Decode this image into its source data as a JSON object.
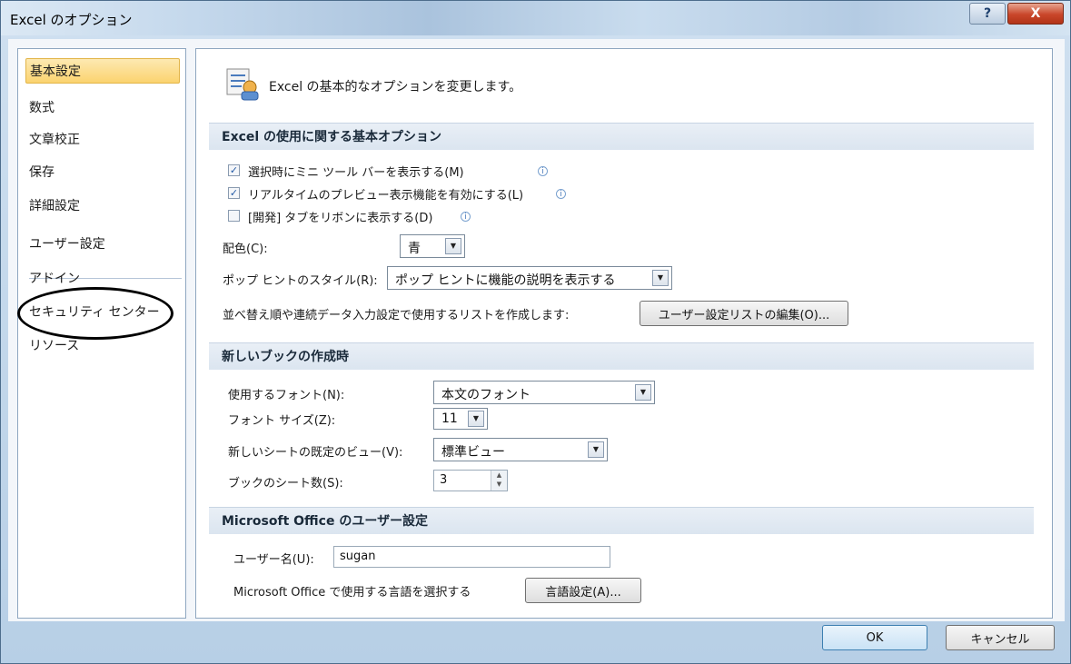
{
  "window": {
    "title": "Excel のオプション",
    "help_label": "?",
    "close_label": "X"
  },
  "sidebar": {
    "items": [
      {
        "label": "基本設定"
      },
      {
        "label": "数式"
      },
      {
        "label": "文章校正"
      },
      {
        "label": "保存"
      },
      {
        "label": "詳細設定"
      },
      {
        "label": "ユーザー設定"
      },
      {
        "label": "アドイン"
      },
      {
        "label": "セキュリティ センター"
      },
      {
        "label": "リソース"
      }
    ]
  },
  "header": {
    "description": "Excel の基本的なオプションを変更します。"
  },
  "section_basic": {
    "title": "Excel の使用に関する基本オプション",
    "options": [
      {
        "label": "選択時にミニ ツール バーを表示する(M)",
        "checked": true
      },
      {
        "label": "リアルタイムのプレビュー表示機能を有効にする(L)",
        "checked": true
      },
      {
        "label": "[開発] タブをリボンに表示する(D)",
        "checked": false
      }
    ],
    "color_label": "配色(C):",
    "color_value": "青",
    "tooltip_label": "ポップ ヒントのスタイル(R):",
    "tooltip_value": "ポップ ヒントに機能の説明を表示する",
    "list_label": "並べ替え順や連続データ入力設定で使用するリストを作成します:",
    "list_button": "ユーザー設定リストの編集(O)..."
  },
  "section_new_book": {
    "title": "新しいブックの作成時",
    "font_label": "使用するフォント(N):",
    "font_value": "本文のフォント",
    "size_label": "フォント サイズ(Z):",
    "size_value": "11",
    "view_label": "新しいシートの既定のビュー(V):",
    "view_value": "標準ビュー",
    "sheets_label": "ブックのシート数(S):",
    "sheets_value": "3"
  },
  "section_user": {
    "title": "Microsoft Office のユーザー設定",
    "username_label": "ユーザー名(U):",
    "username_value": "sugan",
    "language_label": "Microsoft Office で使用する言語を選択する",
    "language_button": "言語設定(A)..."
  },
  "footer": {
    "ok_label": "OK",
    "cancel_label": "キャンセル"
  }
}
